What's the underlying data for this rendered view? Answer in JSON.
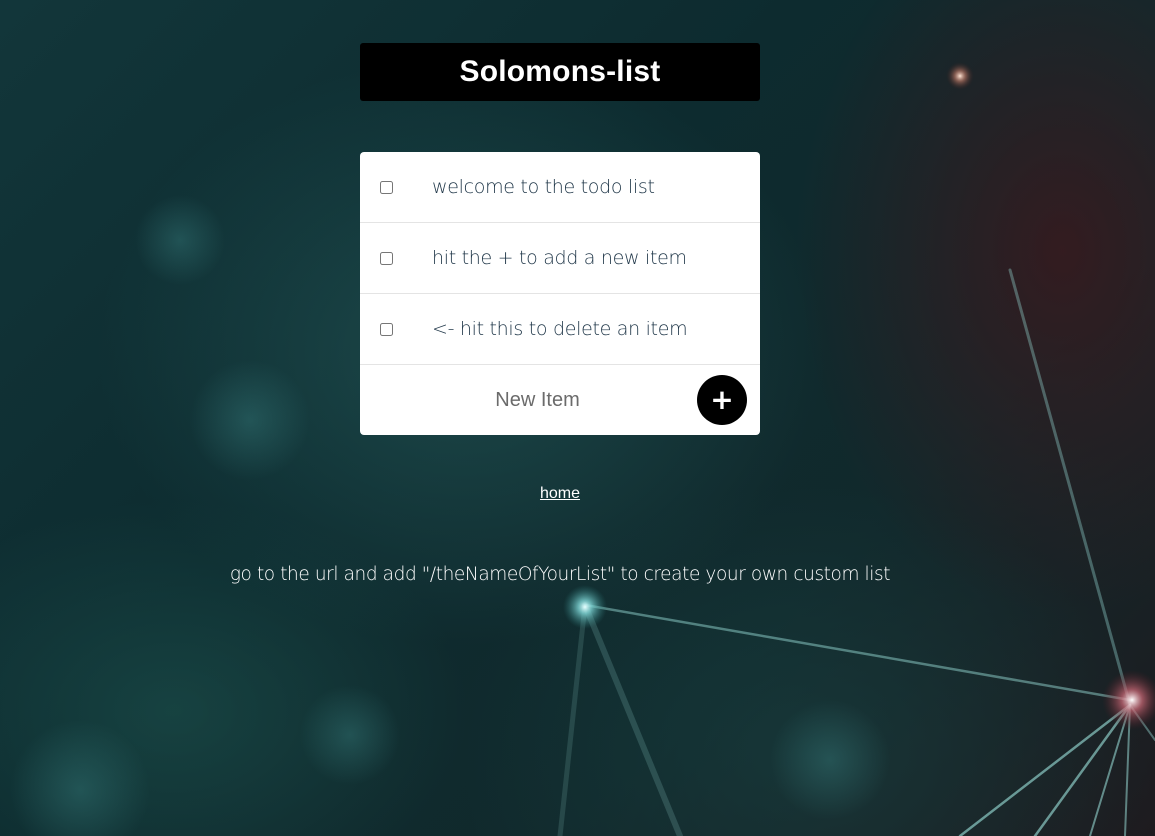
{
  "page": {
    "title": "Solomons-list"
  },
  "todo": {
    "items": [
      {
        "label": "welcome to the todo list",
        "checked": false
      },
      {
        "label": "hit the + to add a new item",
        "checked": false
      },
      {
        "label": "<- hit this to delete an item",
        "checked": false
      }
    ],
    "new_item_placeholder": "New Item",
    "add_button_label": "+"
  },
  "nav": {
    "home_label": "home"
  },
  "footer": {
    "note": "go to the url and add \"/theNameOfYourList\" to create your own custom list"
  },
  "colors": {
    "title_bg": "#000000",
    "card_bg": "#ffffff",
    "item_text": "#1f3648",
    "add_button_bg": "#000000"
  }
}
